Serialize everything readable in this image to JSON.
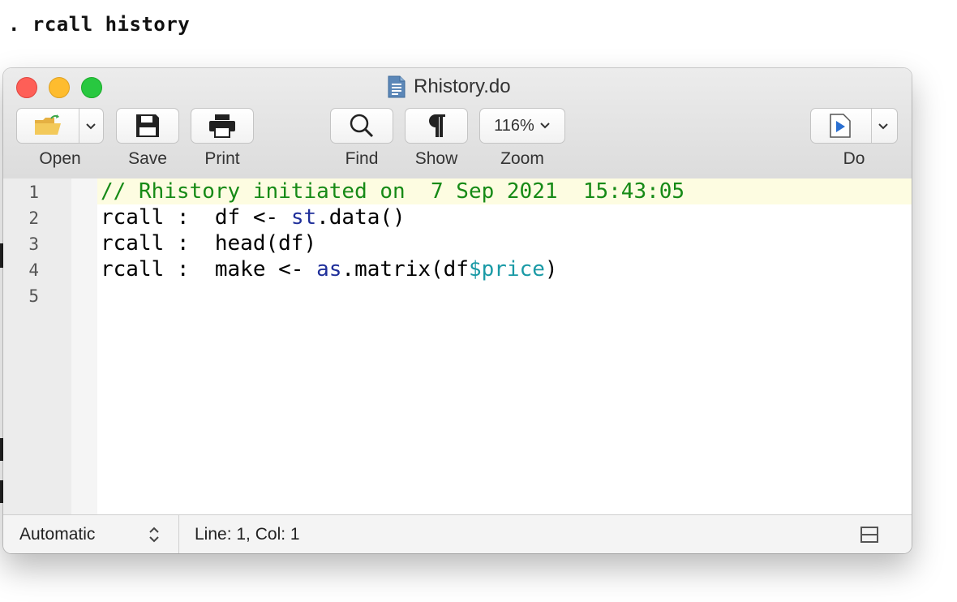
{
  "console": {
    "command": ". rcall history"
  },
  "window": {
    "title": "Rhistory.do"
  },
  "toolbar": {
    "open_label": "Open",
    "save_label": "Save",
    "print_label": "Print",
    "find_label": "Find",
    "show_label": "Show",
    "zoom_label": "Zoom",
    "zoom_value": "116%",
    "do_label": "Do"
  },
  "editor": {
    "line_numbers": [
      "1",
      "2",
      "3",
      "4",
      "5"
    ],
    "lines": [
      {
        "comment": "// Rhistory initiated on  7 Sep 2021  15:43:05"
      },
      {
        "prefix": "rcall :  df <- ",
        "fn": "st",
        "rest": ".data()"
      },
      {
        "prefix": "rcall :  head(df)"
      },
      {
        "prefix": "rcall :  make <- ",
        "fn": "as",
        "rest": ".matrix(df",
        "var": "$price",
        "close": ")"
      },
      {
        "prefix": ""
      }
    ]
  },
  "status": {
    "syntax_mode": "Automatic",
    "position": "Line: 1, Col: 1"
  },
  "colors": {
    "comment": "#168a16",
    "function": "#1f2f9a",
    "variable": "#1a9aa6",
    "current_line": "#fdfce1"
  }
}
